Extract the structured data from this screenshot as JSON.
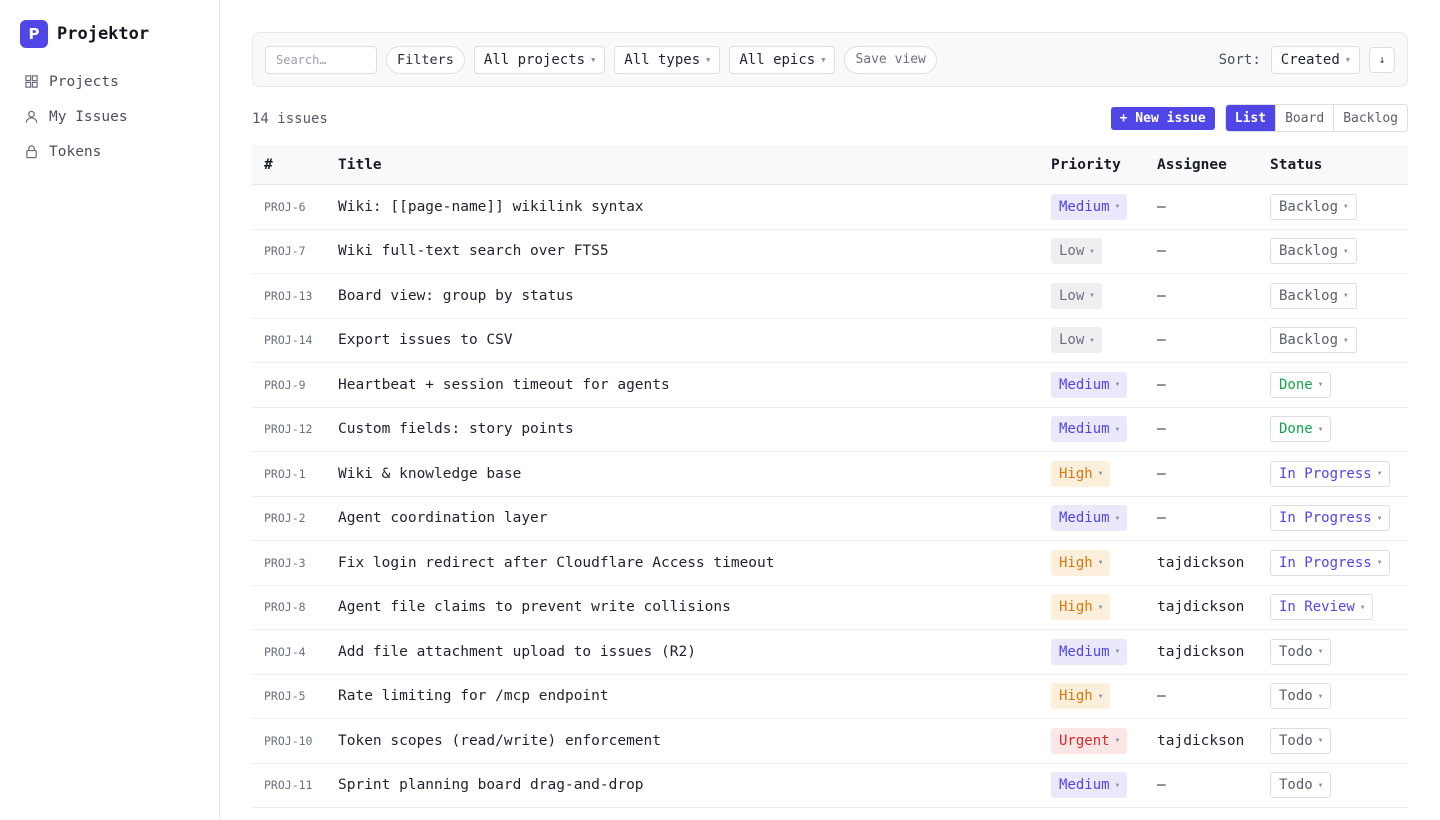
{
  "brand": {
    "logo_letter": "P",
    "name": "Projektor"
  },
  "sidebar": {
    "items": [
      {
        "label": "Projects",
        "icon": "grid-icon"
      },
      {
        "label": "My Issues",
        "icon": "user-icon"
      },
      {
        "label": "Tokens",
        "icon": "lock-icon"
      }
    ]
  },
  "toolbar": {
    "search_placeholder": "Search…",
    "filters_label": "Filters",
    "projects_select": "All projects",
    "types_select": "All types",
    "epics_select": "All epics",
    "save_view_label": "Save view",
    "sort_label": "Sort:",
    "sort_value": "Created",
    "sort_direction_symbol": "↓"
  },
  "subbar": {
    "issue_count": "14 issues",
    "new_issue_label": "+ New issue",
    "views": [
      "List",
      "Board",
      "Backlog"
    ],
    "active_view": "List"
  },
  "table": {
    "headers": {
      "id": "#",
      "title": "Title",
      "priority": "Priority",
      "assignee": "Assignee",
      "status": "Status"
    },
    "rows": [
      {
        "id": "PROJ-6",
        "title": "Wiki: [[page-name]] wikilink syntax",
        "priority": "Medium",
        "assignee": "—",
        "status": "Backlog"
      },
      {
        "id": "PROJ-7",
        "title": "Wiki full-text search over FTS5",
        "priority": "Low",
        "assignee": "—",
        "status": "Backlog"
      },
      {
        "id": "PROJ-13",
        "title": "Board view: group by status",
        "priority": "Low",
        "assignee": "—",
        "status": "Backlog"
      },
      {
        "id": "PROJ-14",
        "title": "Export issues to CSV",
        "priority": "Low",
        "assignee": "—",
        "status": "Backlog"
      },
      {
        "id": "PROJ-9",
        "title": "Heartbeat + session timeout for agents",
        "priority": "Medium",
        "assignee": "—",
        "status": "Done"
      },
      {
        "id": "PROJ-12",
        "title": "Custom fields: story points",
        "priority": "Medium",
        "assignee": "—",
        "status": "Done"
      },
      {
        "id": "PROJ-1",
        "title": "Wiki & knowledge base",
        "priority": "High",
        "assignee": "—",
        "status": "In Progress"
      },
      {
        "id": "PROJ-2",
        "title": "Agent coordination layer",
        "priority": "Medium",
        "assignee": "—",
        "status": "In Progress"
      },
      {
        "id": "PROJ-3",
        "title": "Fix login redirect after Cloudflare Access timeout",
        "priority": "High",
        "assignee": "tajdickson",
        "status": "In Progress"
      },
      {
        "id": "PROJ-8",
        "title": "Agent file claims to prevent write collisions",
        "priority": "High",
        "assignee": "tajdickson",
        "status": "In Review"
      },
      {
        "id": "PROJ-4",
        "title": "Add file attachment upload to issues (R2)",
        "priority": "Medium",
        "assignee": "tajdickson",
        "status": "Todo"
      },
      {
        "id": "PROJ-5",
        "title": "Rate limiting for /mcp endpoint",
        "priority": "High",
        "assignee": "—",
        "status": "Todo"
      },
      {
        "id": "PROJ-10",
        "title": "Token scopes (read/write) enforcement",
        "priority": "Urgent",
        "assignee": "tajdickson",
        "status": "Todo"
      },
      {
        "id": "PROJ-11",
        "title": "Sprint planning board drag-and-drop",
        "priority": "Medium",
        "assignee": "—",
        "status": "Todo"
      }
    ]
  },
  "colors": {
    "accent": "#4f46e5",
    "priority_medium": "#4f46e5",
    "priority_low": "#6b7080",
    "priority_high": "#d9770a",
    "priority_urgent": "#dc2626",
    "status_done": "#16a34a"
  }
}
